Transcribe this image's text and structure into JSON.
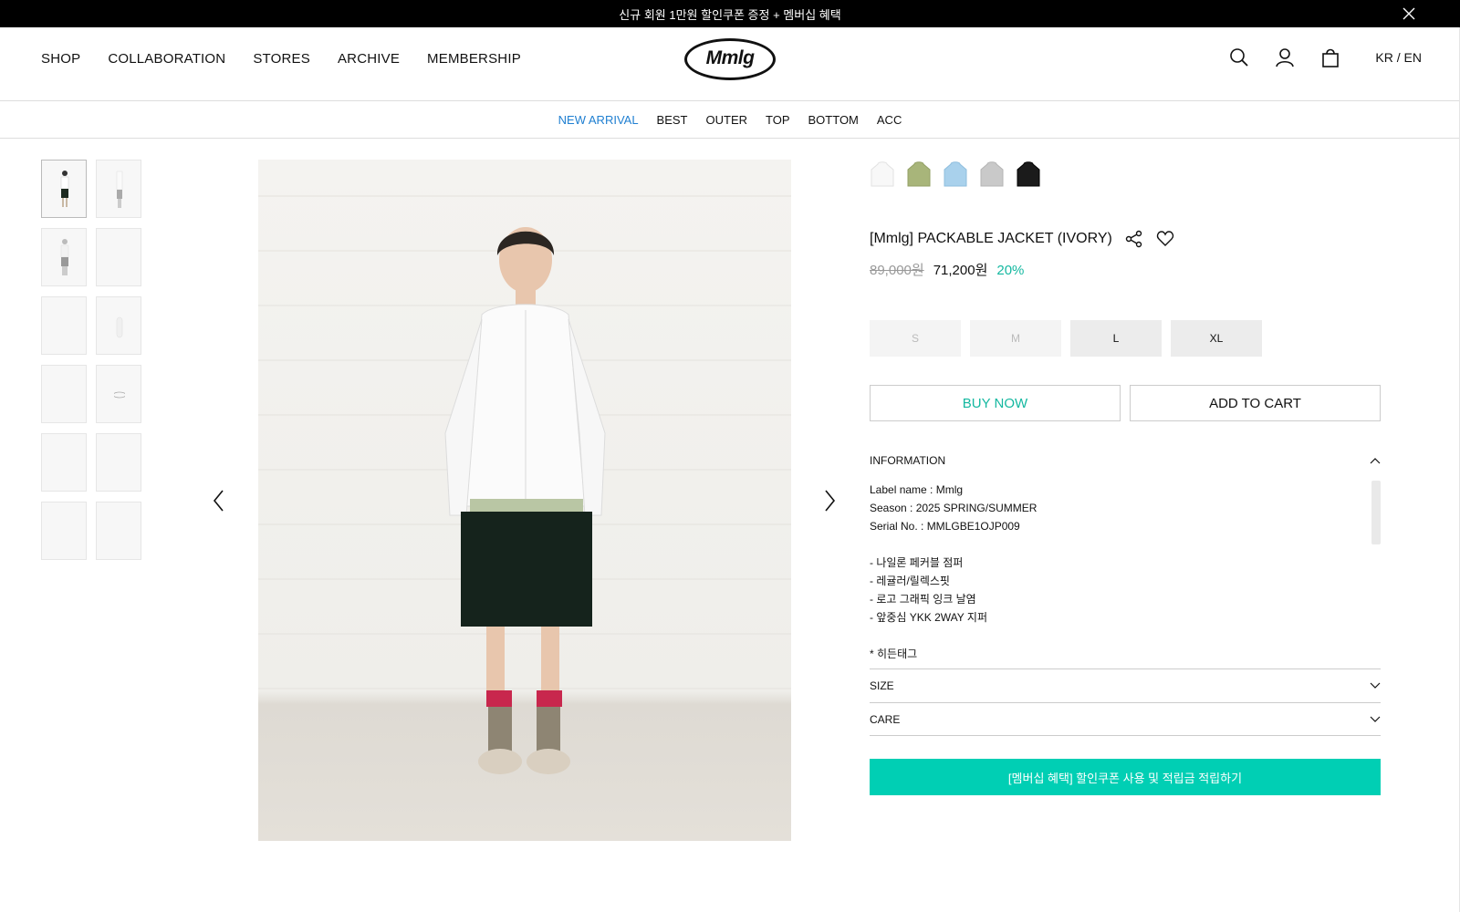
{
  "promo_bar": {
    "text": "신규 회원 1만원 할인쿠폰 증정 + 멤버십 혜택"
  },
  "header": {
    "nav": [
      "SHOP",
      "COLLABORATION",
      "STORES",
      "ARCHIVE",
      "MEMBERSHIP"
    ],
    "logo": "Mmlg",
    "lang": "KR / EN"
  },
  "subnav": [
    "NEW ARRIVAL",
    "BEST",
    "OUTER",
    "TOP",
    "BOTTOM",
    "ACC"
  ],
  "colors": {
    "accent": "#00cfb4",
    "sale": "#14b8a0",
    "active_link": "#1f7fd1"
  },
  "swatches": [
    "ivory",
    "green",
    "sky-blue",
    "gray",
    "black"
  ],
  "product": {
    "title": "[Mmlg] PACKABLE JACKET (IVORY)",
    "original_price": "89,000원",
    "sale_price": "71,200원",
    "discount": "20%"
  },
  "sizes": [
    "S",
    "M",
    "L",
    "XL"
  ],
  "buttons": {
    "buy_now": "BUY NOW",
    "add_to_cart": "ADD TO CART"
  },
  "information": {
    "label": "INFORMATION",
    "lines": [
      "Label name : Mmlg",
      "Season : 2025 SPRING/SUMMER",
      "Serial No. : MMLGBE1OJP009",
      "",
      "- 나일론 페커블 점퍼",
      "- 레귤러/릴렉스핏",
      "- 로고 그래픽 잉크 날염",
      "- 앞중심 YKK 2WAY 지퍼",
      "",
      "* 히든태그"
    ]
  },
  "size_section": {
    "label": "SIZE"
  },
  "care_section": {
    "label": "CARE"
  },
  "membership_button": "[멤버십 혜택] 할인쿠폰 사용 및 적립금 적립하기"
}
